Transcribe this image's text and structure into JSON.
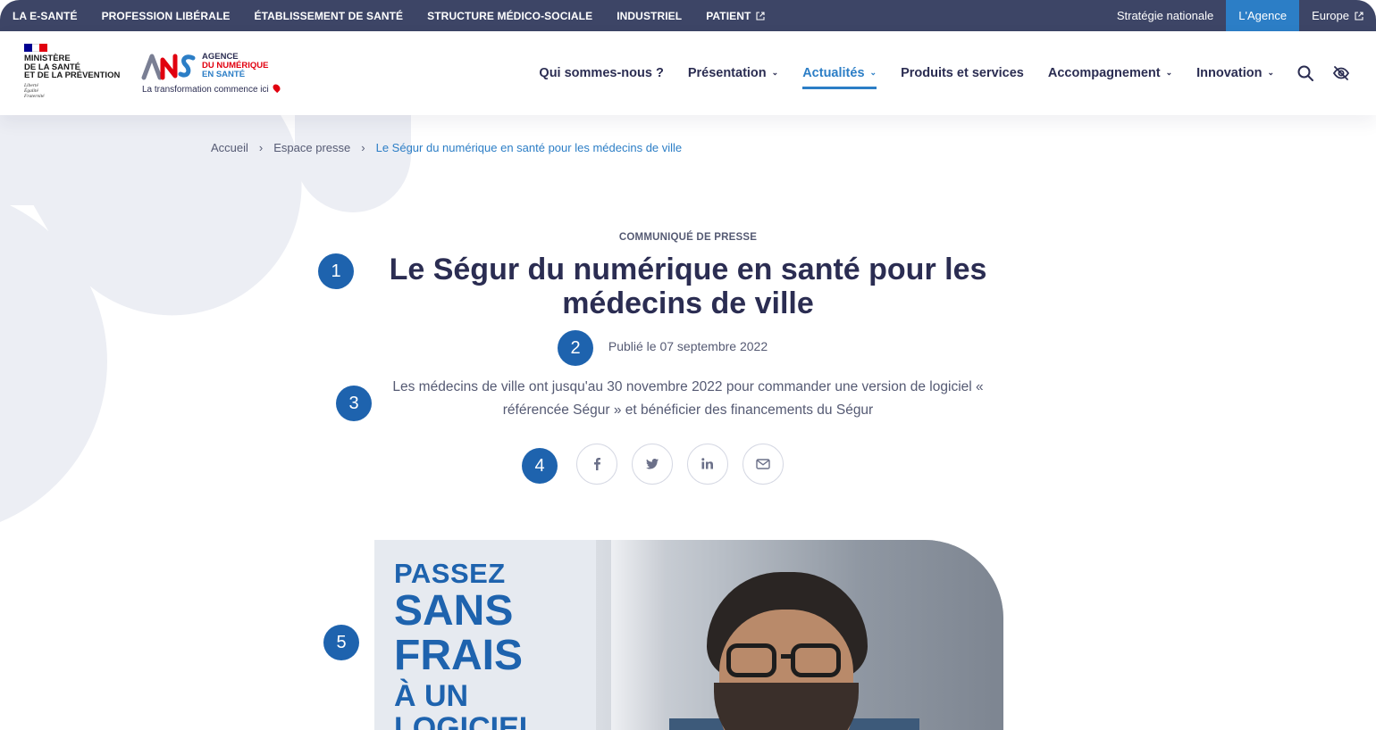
{
  "topbar": {
    "left_links": [
      "LA E-SANTÉ",
      "PROFESSION LIBÉRALE",
      "ÉTABLISSEMENT DE SANTÉ",
      "STRUCTURE MÉDICO-SOCIALE",
      "INDUSTRIEL",
      "PATIENT"
    ],
    "right_links": [
      "Stratégie nationale",
      "L'Agence",
      "Europe"
    ],
    "active_right": "L'Agence"
  },
  "header": {
    "ministry_name": "MINISTÈRE\nDE LA SANTÉ\nET DE LA PRÉVENTION",
    "ministry_motto": "Liberté\nÉgalité\nFraternité",
    "ans_line1": "AGENCE",
    "ans_line2": "DU NUMÉRIQUE",
    "ans_line3": "EN SANTÉ",
    "ans_tagline": "La transformation commence ici",
    "nav": [
      {
        "label": "Qui sommes-nous ?"
      },
      {
        "label": "Présentation"
      },
      {
        "label": "Actualités"
      },
      {
        "label": "Produits et services"
      },
      {
        "label": "Accompagnement"
      },
      {
        "label": "Innovation"
      }
    ],
    "active_nav": "Actualités",
    "icons": [
      "search-icon",
      "eye-off-icon"
    ]
  },
  "breadcrumb": {
    "items": [
      "Accueil",
      "Espace presse",
      "Le Ségur du numérique en santé pour les médecins de ville"
    ],
    "separator": "›"
  },
  "article": {
    "kicker": "COMMUNIQUÉ DE PRESSE",
    "title": "Le Ségur du numérique en santé pour les médecins de ville",
    "date": "Publié le 07 septembre 2022",
    "lede": "Les médecins de ville ont jusqu'au 30 novembre 2022 pour commander une version de logiciel « référencée Ségur » et bénéficier des financements du Ségur",
    "share_icons": [
      "facebook-icon",
      "twitter-icon",
      "linkedin-icon",
      "email-icon"
    ]
  },
  "hero": {
    "promo_lines": [
      "PASSEZ",
      "SANS",
      "FRAIS",
      "À UN",
      "LOGICIEL"
    ]
  },
  "markers": [
    "1",
    "2",
    "3",
    "4",
    "5"
  ],
  "colors": {
    "topbar_bg": "#3d4566",
    "accent": "#2c7ec6",
    "marker": "#1e63ae",
    "text_dark": "#2b2d52",
    "ans_red": "#e1000f"
  }
}
